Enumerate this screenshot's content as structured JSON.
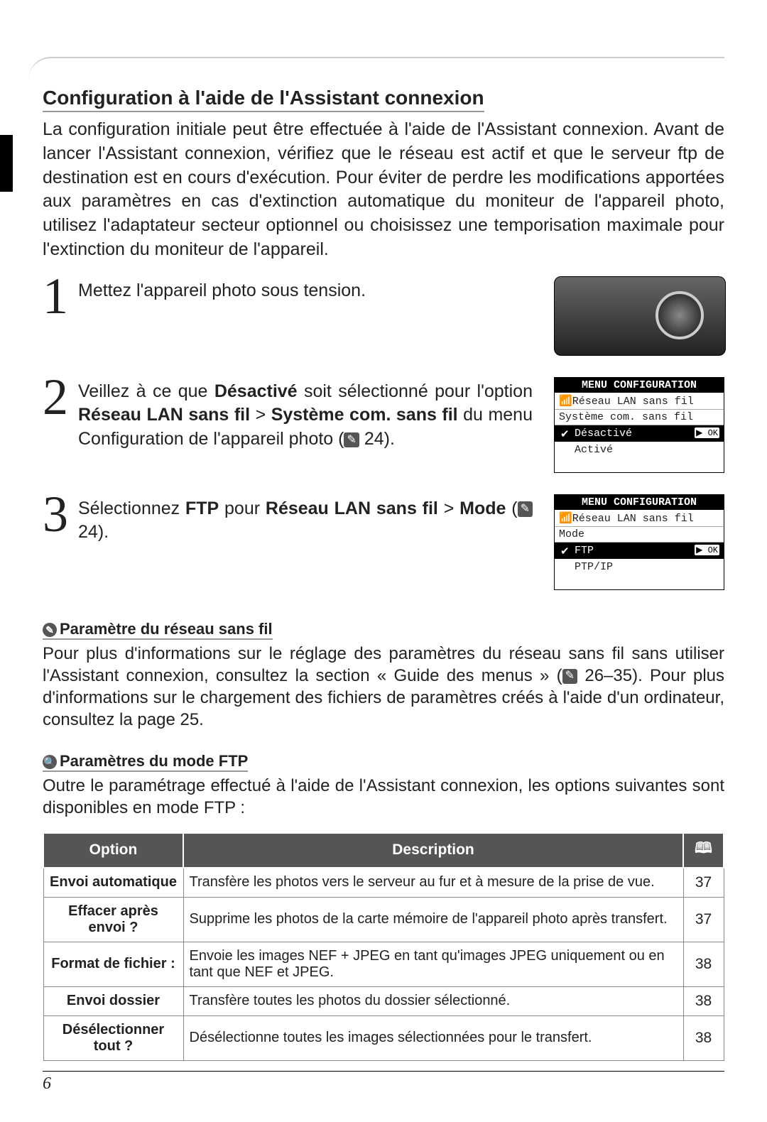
{
  "section_title": "Configuration à l'aide de l'Assistant connexion",
  "intro": "La configuration initiale peut être effectuée à l'aide de l'Assistant connexion. Avant de lancer l'Assistant connexion, vérifiez que le réseau est actif et que le serveur ftp de destination est en cours d'exécution. Pour éviter de perdre les modifications apportées aux paramètres en cas d'extinction automatique du moniteur de l'appareil photo, utilisez l'adaptateur secteur optionnel ou choisissez une temporisation maximale pour l'extinction du moniteur de l'appareil.",
  "steps": [
    {
      "num": "1",
      "text_plain": "Mettez l'appareil photo sous tension.",
      "figure": "camera"
    },
    {
      "num": "2",
      "text_pre": "Veillez à ce que ",
      "b1": "Désactivé",
      "text_mid1": " soit sélectionné pour l'option ",
      "b2": "Réseau LAN sans fil",
      "gt1": " > ",
      "b3": "Système com. sans fil",
      "text_mid2": " du menu Configuration de l'appareil photo (",
      "ref": "24",
      "text_end": ").",
      "figure": "lcd1"
    },
    {
      "num": "3",
      "text_pre": "Sélectionnez ",
      "b1": "FTP",
      "text_mid1": " pour ",
      "b2": "Réseau LAN sans fil",
      "gt1": " > ",
      "b3": "Mode",
      "text_mid2": " (",
      "ref": "24",
      "text_end": ").",
      "figure": "lcd2"
    }
  ],
  "lcd1": {
    "header": "MENU CONFIGURATION",
    "sub1": "Réseau LAN sans fil",
    "sub2": "Système com. sans fil",
    "row_sel": "Désactivé",
    "row_ok": "▶ OK",
    "row2": "Activé"
  },
  "lcd2": {
    "header": "MENU CONFIGURATION",
    "sub1": "Réseau LAN sans fil",
    "sub2": "Mode",
    "row_sel": "FTP",
    "row_ok": "▶ OK",
    "row2": "PTP/IP"
  },
  "note1": {
    "title": "Paramètre du réseau sans fil",
    "body_pre": "Pour plus d'informations sur le réglage des paramètres du réseau sans fil sans utiliser l'Assistant connexion, consultez la section « Guide des menus » (",
    "ref": "26–35",
    "body_post": "). Pour plus d'informations sur le chargement des fichiers de paramètres créés à l'aide d'un ordinateur, consultez la page 25."
  },
  "note2": {
    "title": "Paramètres du mode FTP",
    "body": "Outre le paramétrage effectué à l'aide de l'Assistant connexion, les options suivantes sont disponibles en mode FTP :"
  },
  "table": {
    "h1": "Option",
    "h2": "Description",
    "h3_icon": "⎘",
    "rows": [
      {
        "opt": "Envoi automatique",
        "desc": "Transfère les photos vers le serveur au fur et à mesure de la prise de vue.",
        "pg": "37"
      },
      {
        "opt": "Effacer après envoi ?",
        "desc": "Supprime les photos de la carte mémoire de l'appareil photo après transfert.",
        "pg": "37"
      },
      {
        "opt": "Format de fichier :",
        "desc": "Envoie les images NEF + JPEG en tant qu'images JPEG uniquement ou en tant que NEF et JPEG.",
        "pg": "38"
      },
      {
        "opt": "Envoi dossier",
        "desc": "Transfère toutes les photos du dossier sélectionné.",
        "pg": "38"
      },
      {
        "opt": "Désélectionner tout ?",
        "desc": "Désélectionne toutes les images sélectionnées pour le transfert.",
        "pg": "38"
      }
    ]
  },
  "page_number": "6"
}
